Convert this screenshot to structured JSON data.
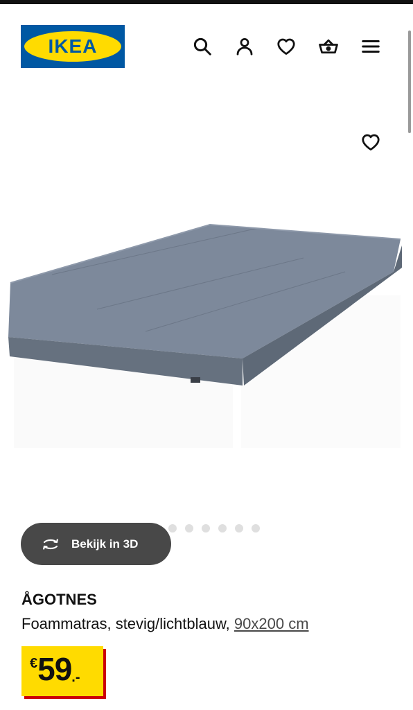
{
  "header": {
    "logo_text": "IKEA",
    "icons": [
      "search-icon",
      "account-icon",
      "heart-icon",
      "basket-icon",
      "menu-icon"
    ]
  },
  "gallery": {
    "favorite_icon": "heart-icon",
    "view3d_label": "Bekijk in 3D",
    "view3d_icon": "rotate-3d-icon",
    "image_count": 7,
    "active_index": 0
  },
  "product": {
    "name": "ÅGOTNES",
    "description": "Foammatras, stevig/lichtblauw, ",
    "size_link": "90x200 cm",
    "price": {
      "currency": "€",
      "integer": "59",
      "decimal": ".-"
    }
  },
  "colors": {
    "brand_blue": "#0058a3",
    "brand_yellow": "#ffdb00",
    "price_shadow_red": "#cc0008",
    "button_dark": "#484848",
    "mattress": "#7b8798"
  }
}
